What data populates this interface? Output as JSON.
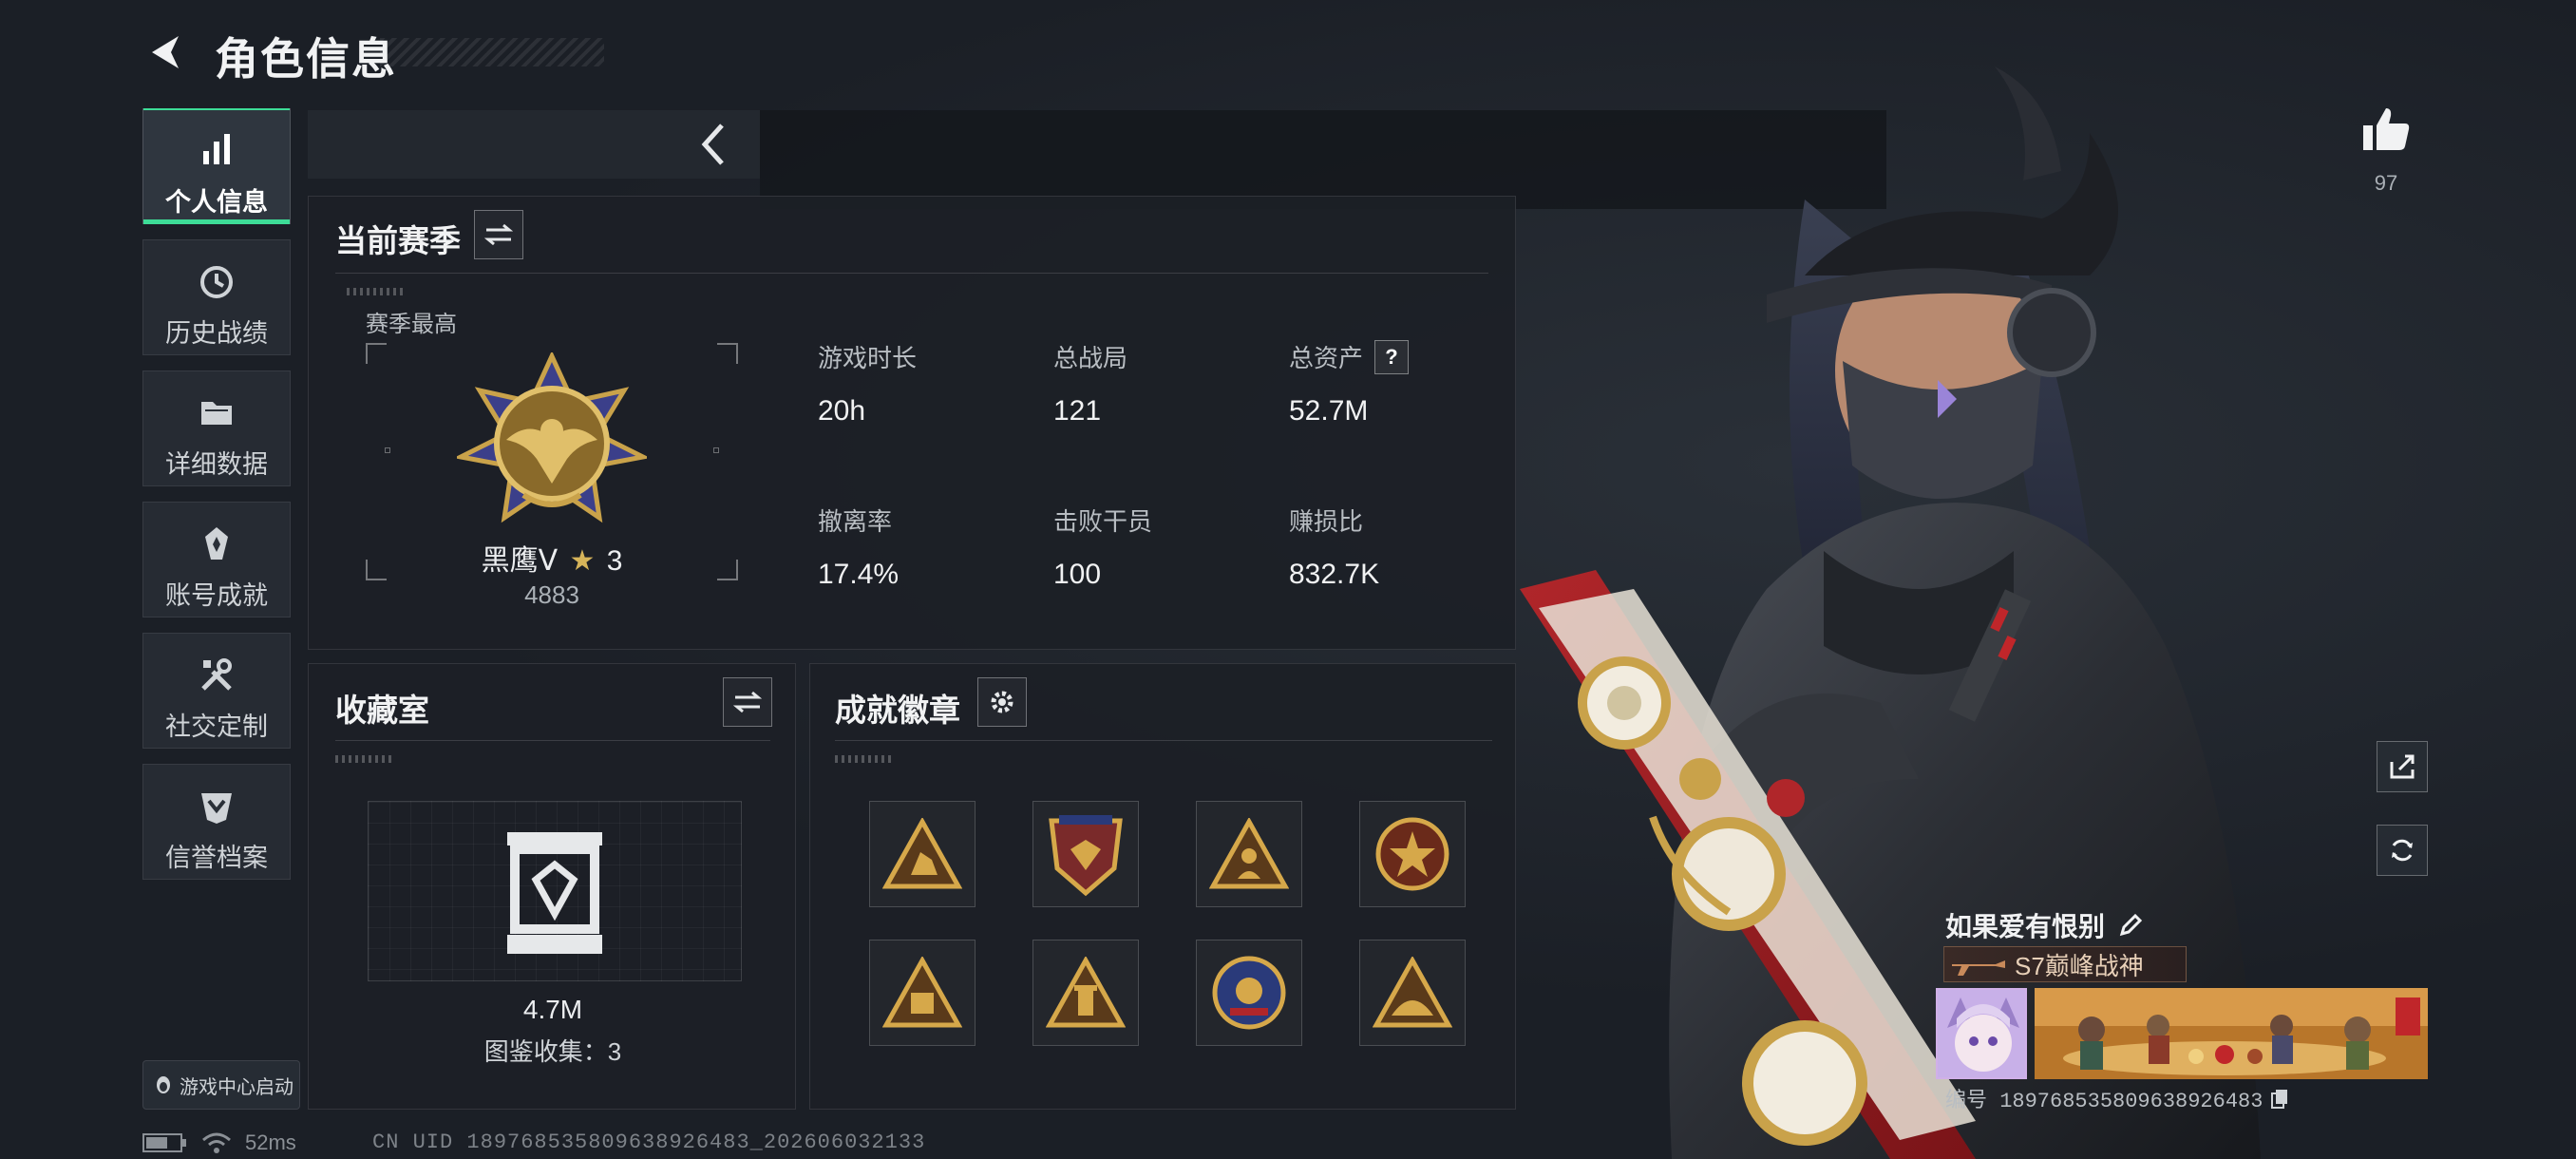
{
  "header": {
    "title": "角色信息"
  },
  "sidebar": {
    "items": [
      {
        "label": "个人信息",
        "icon": "bar-chart-icon",
        "active": true
      },
      {
        "label": "历史战绩",
        "icon": "clock-history-icon",
        "active": false
      },
      {
        "label": "详细数据",
        "icon": "folder-icon",
        "active": false
      },
      {
        "label": "账号成就",
        "icon": "achievement-medal-icon",
        "active": false
      },
      {
        "label": "社交定制",
        "icon": "wrench-tools-icon",
        "active": false
      },
      {
        "label": "信誉档案",
        "icon": "shield-chevron-icon",
        "active": false
      }
    ],
    "game_center_label": "游戏中心启动"
  },
  "status": {
    "ping": "52ms",
    "uid_line": "CN UID 18976853580963892648​3_202606032133"
  },
  "season": {
    "title": "当前赛季",
    "best_label": "赛季最高",
    "rank_name": "黑鹰Ⅴ",
    "rank_stars": "3",
    "rank_score": "4883",
    "stats": [
      {
        "label": "游戏时长",
        "value": "20h"
      },
      {
        "label": "总战局",
        "value": "121"
      },
      {
        "label": "总资产",
        "value": "52.7M",
        "help": "?"
      },
      {
        "label": "撤离率",
        "value": "17.4%"
      },
      {
        "label": "击败干员",
        "value": "100"
      },
      {
        "label": "赚损比",
        "value": "832.7K"
      }
    ]
  },
  "collection": {
    "title": "收藏室",
    "value": "4.7M",
    "count_text": "图鉴收集：3"
  },
  "achievements": {
    "title": "成就徽章",
    "badges": [
      "triangle-soldier-badge",
      "shield-eagle-badge",
      "triangle-figure-badge",
      "star-roundel-badge",
      "triangle-crate-badge",
      "triangle-box-badge",
      "roundel-skull-badge",
      "triangle-mountain-badge"
    ]
  },
  "profile": {
    "like_count": "97",
    "player_name": "如果爱有恨别",
    "title_banner": "S7巅峰战神",
    "id_text": "编号 18976853580963892648​3"
  },
  "colors": {
    "accent_green": "#3ddc97",
    "gold": "#c9a24a",
    "panel_bg": "#1c2026"
  }
}
